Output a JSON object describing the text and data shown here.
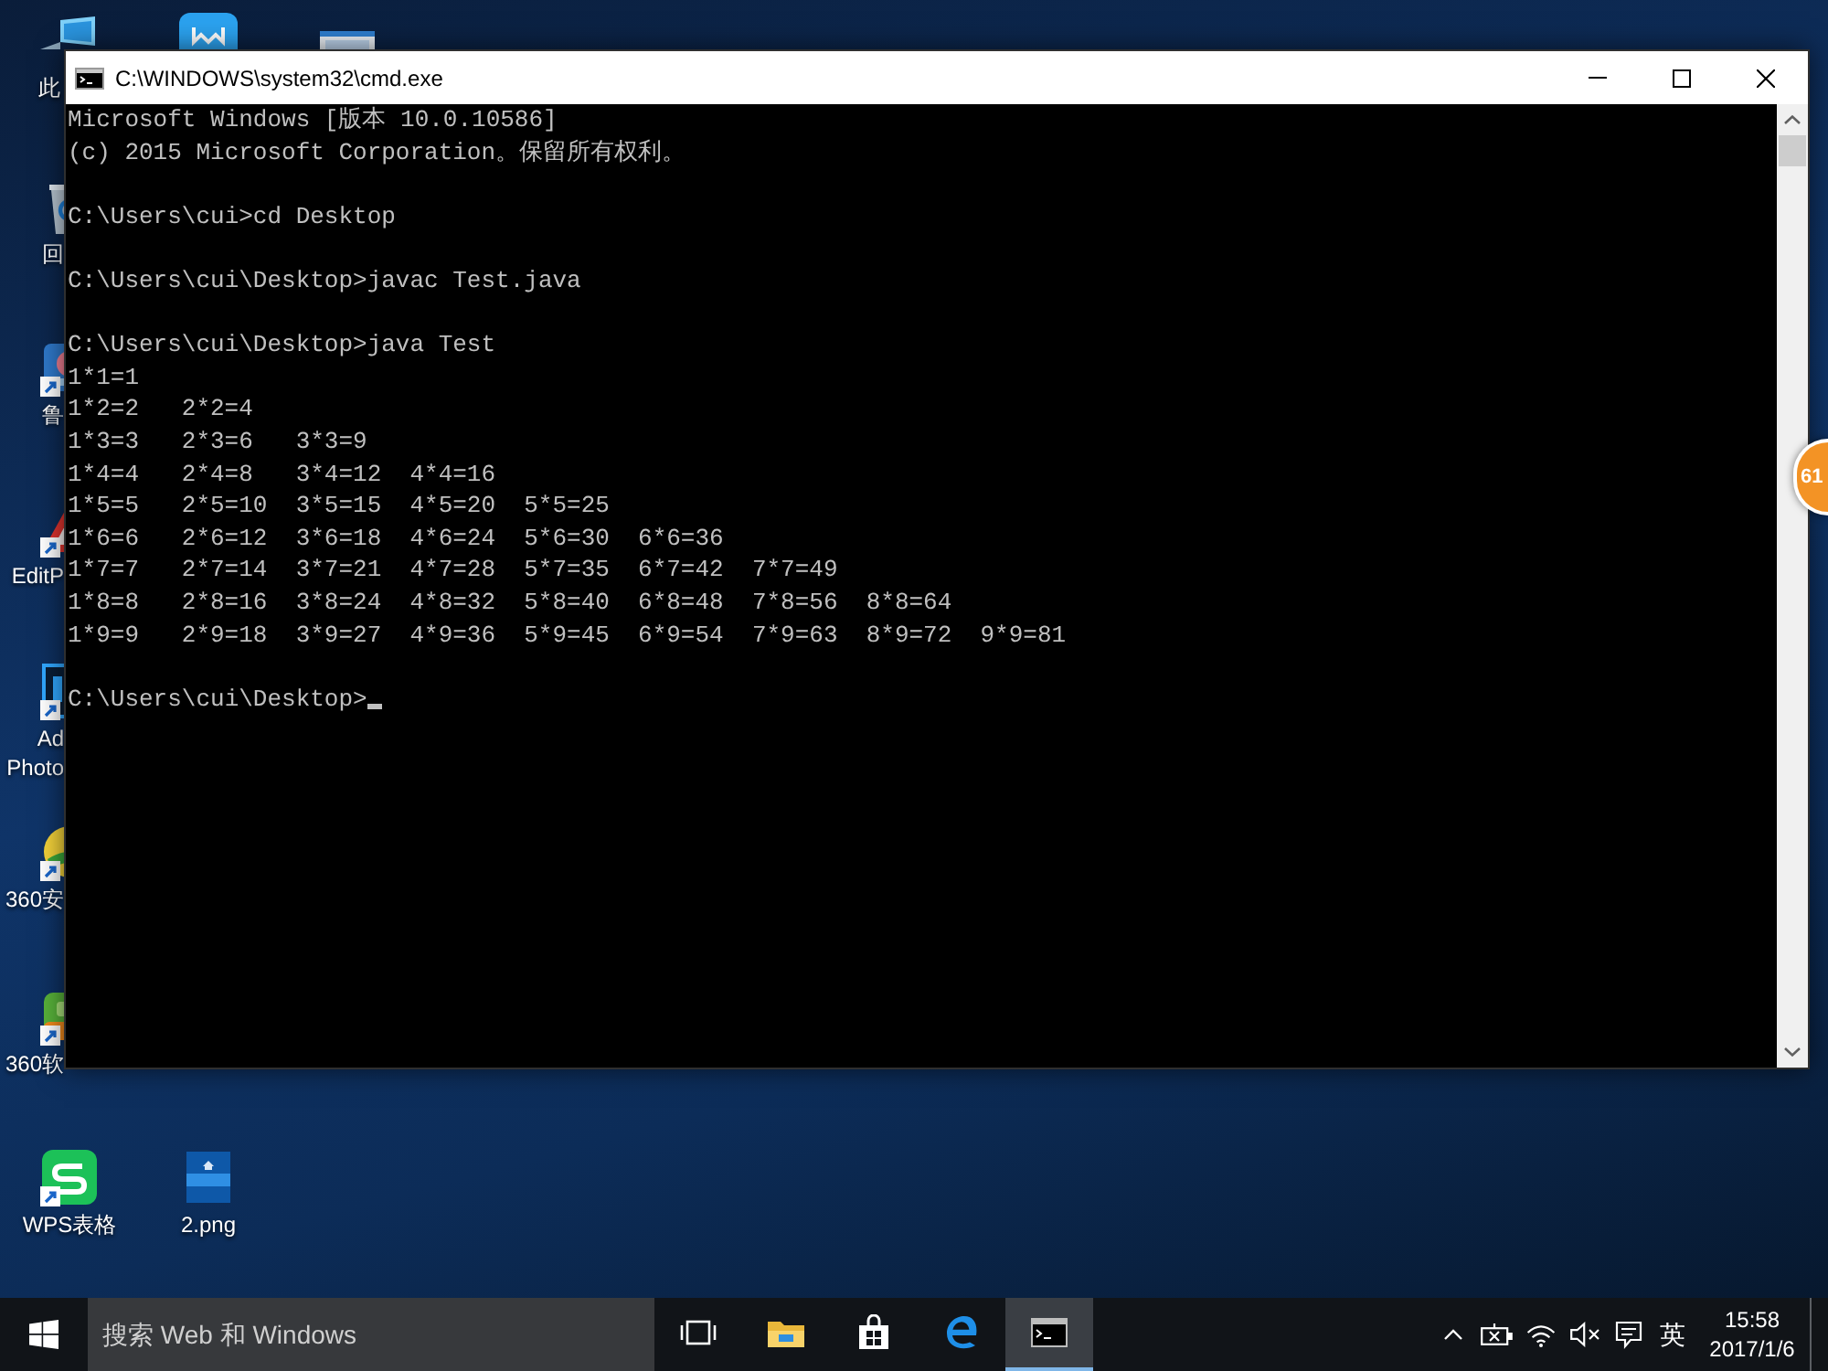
{
  "desktop_icons": [
    {
      "kind": "monitor",
      "label_lines": [
        "此"
      ]
    },
    {
      "kind": "bin",
      "shortcut": false,
      "label_lines": [
        "回"
      ]
    },
    {
      "kind": "gadget",
      "shortcut": true,
      "label_lines": [
        "鲁"
      ]
    },
    {
      "kind": "triangle",
      "shortcut": true,
      "label_lines": [
        "EditP"
      ]
    },
    {
      "kind": "square",
      "shortcut": true,
      "label_lines": [
        "Ad",
        "Photo"
      ]
    },
    {
      "kind": "ball",
      "shortcut": true,
      "label_lines": [
        "360安"
      ]
    },
    {
      "kind": "bag",
      "shortcut": true,
      "label_lines": [
        "360软"
      ]
    },
    {
      "kind": "tile",
      "shortcut": true,
      "label_lines": [
        "WPS表格"
      ]
    },
    {
      "kind": "app"
    },
    {
      "kind": "picture",
      "shortcut": false,
      "label_lines": [
        "2.png"
      ]
    },
    {
      "kind": "document"
    }
  ],
  "window": {
    "title": "C:\\WINDOWS\\system32\\cmd.exe",
    "console": {
      "cursor": true,
      "lines": [
        {
          "kind": "text",
          "text": "Microsoft Windows [版本 10.0.10586]"
        },
        {
          "kind": "text",
          "text": "(c) 2015 Microsoft Corporation。保留所有权利。"
        },
        {
          "kind": "blank"
        },
        {
          "kind": "text",
          "text": "C:\\Users\\cui>cd Desktop"
        },
        {
          "kind": "blank"
        },
        {
          "kind": "text",
          "text": "C:\\Users\\cui\\Desktop>javac Test.java"
        },
        {
          "kind": "blank"
        },
        {
          "kind": "text",
          "text": "C:\\Users\\cui\\Desktop>java Test"
        },
        {
          "kind": "columns",
          "cells": [
            "1*1=1"
          ]
        },
        {
          "kind": "columns",
          "cells": [
            "1*2=2",
            "2*2=4"
          ]
        },
        {
          "kind": "columns",
          "cells": [
            "1*3=3",
            "2*3=6",
            "3*3=9"
          ]
        },
        {
          "kind": "columns",
          "cells": [
            "1*4=4",
            "2*4=8",
            "3*4=12",
            "4*4=16"
          ]
        },
        {
          "kind": "columns",
          "cells": [
            "1*5=5",
            "2*5=10",
            "3*5=15",
            "4*5=20",
            "5*5=25"
          ]
        },
        {
          "kind": "columns",
          "cells": [
            "1*6=6",
            "2*6=12",
            "3*6=18",
            "4*6=24",
            "5*6=30",
            "6*6=36"
          ]
        },
        {
          "kind": "columns",
          "cells": [
            "1*7=7",
            "2*7=14",
            "3*7=21",
            "4*7=28",
            "5*7=35",
            "6*7=42",
            "7*7=49"
          ]
        },
        {
          "kind": "columns",
          "cells": [
            "1*8=8",
            "2*8=16",
            "3*8=24",
            "4*8=32",
            "5*8=40",
            "6*8=48",
            "7*8=56",
            "8*8=64"
          ]
        },
        {
          "kind": "columns",
          "cells": [
            "1*9=9",
            "2*9=18",
            "3*9=27",
            "4*9=36",
            "5*9=45",
            "6*9=54",
            "7*9=63",
            "8*9=72",
            "9*9=81"
          ]
        },
        {
          "kind": "blank"
        },
        {
          "kind": "text",
          "text": "C:\\Users\\cui\\Desktop>"
        }
      ]
    }
  },
  "floating_ball": {
    "text": "61"
  },
  "taskbar": {
    "search": {
      "placeholder": "搜索 Web 和 Windows"
    },
    "apps": [
      {
        "kind": "task_view",
        "selected": false
      },
      {
        "kind": "folder",
        "selected": false
      },
      {
        "kind": "store",
        "selected": false
      },
      {
        "kind": "browser",
        "selected": false
      },
      {
        "kind": "terminal",
        "selected": true
      }
    ],
    "tray": {
      "input_method": "英",
      "time": "15:58",
      "date": "2017/1/6"
    }
  }
}
